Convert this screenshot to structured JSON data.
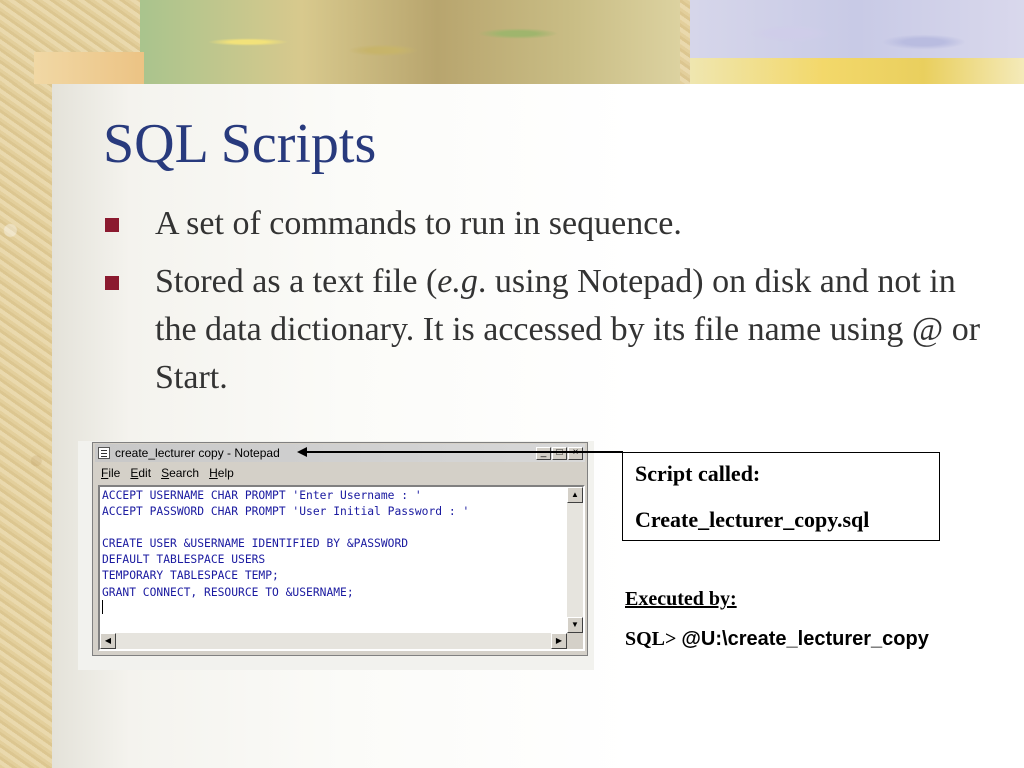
{
  "slide": {
    "title": "SQL Scripts",
    "bullets": [
      {
        "text": "A set of commands to run in sequence."
      },
      {
        "pre": "Stored as a text file (",
        "italic": "e.g",
        "post": ". using Notepad) on disk and not in the data dictionary.  It is accessed by its file name using @ or Start."
      }
    ],
    "bullet_color": "#8b1a2f",
    "title_color": "#283a7d"
  },
  "notepad": {
    "title": "create_lecturer copy - Notepad",
    "icon": "notepad-icon",
    "menu": [
      "File",
      "Edit",
      "Search",
      "Help"
    ],
    "content": "ACCEPT USERNAME CHAR PROMPT 'Enter Username : '\nACCEPT PASSWORD CHAR PROMPT 'User Initial Password : '\n\nCREATE USER &USERNAME IDENTIFIED BY &PASSWORD\nDEFAULT TABLESPACE USERS\nTEMPORARY TABLESPACE TEMP;\nGRANT CONNECT, RESOURCE TO &USERNAME;",
    "text_color": "#1a1aa0"
  },
  "script_box": {
    "label": "Script called:",
    "filename": "Create_lecturer_copy.sql"
  },
  "executed": {
    "label": "Executed by:",
    "prompt": "SQL> ",
    "command": "@U:\\create_lecturer_copy"
  }
}
